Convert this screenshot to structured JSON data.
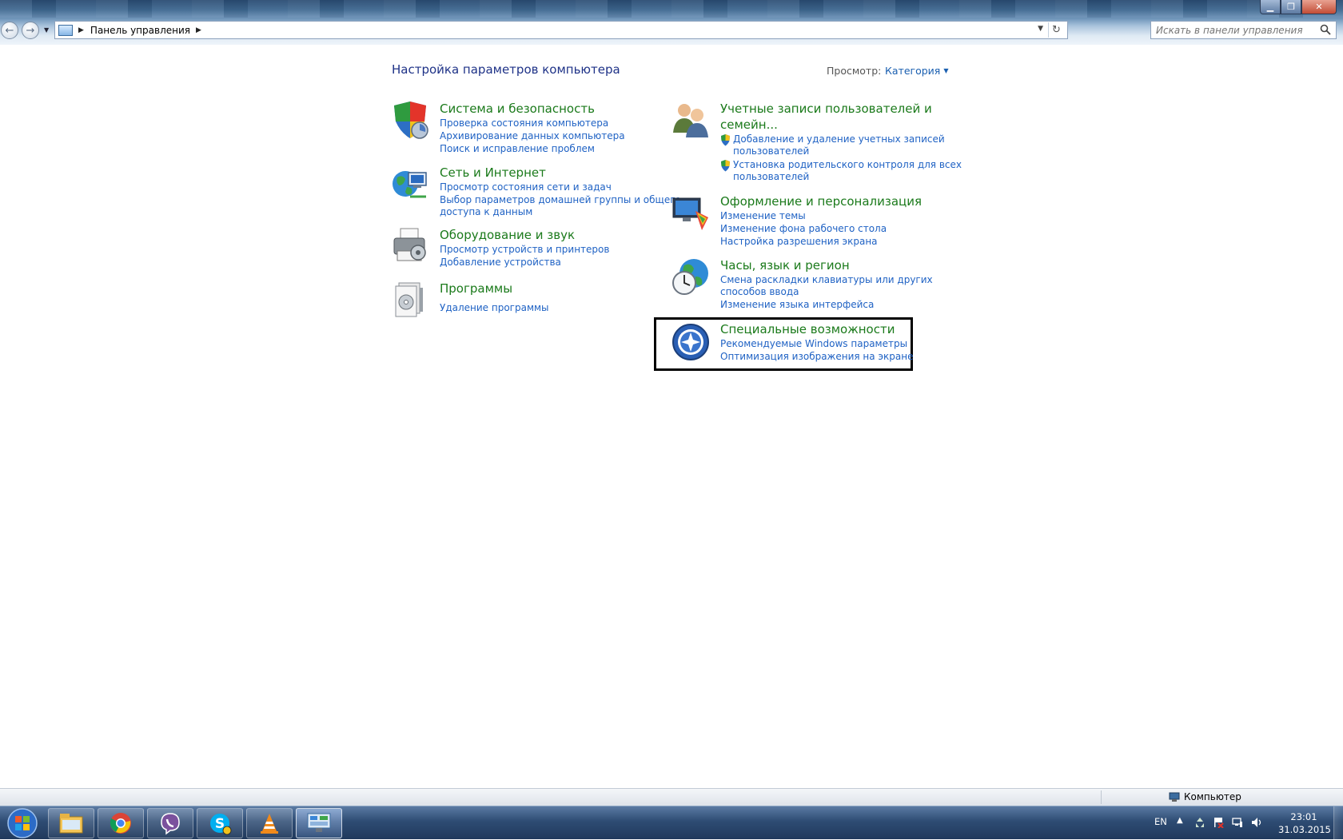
{
  "window": {
    "controls": {
      "minimize": "minimize-icon",
      "maximize": "restore-icon",
      "close": "close-icon"
    }
  },
  "nav": {
    "back_icon": "back-arrow-icon",
    "forward_icon": "forward-arrow-icon",
    "breadcrumb": [
      "Панель управления"
    ],
    "search_placeholder": "Искать в панели управления"
  },
  "content": {
    "title": "Настройка параметров компьютера",
    "view_label": "Просмотр:",
    "view_value": "Категория",
    "left_categories": [
      {
        "title": "Система и безопасность",
        "icon": "shield-icon",
        "links": [
          "Проверка состояния компьютера",
          "Архивирование данных компьютера",
          "Поиск и исправление проблем"
        ]
      },
      {
        "title": "Сеть и Интернет",
        "icon": "network-globe-icon",
        "links": [
          "Просмотр состояния сети и задач",
          "Выбор параметров домашней группы и общего",
          "доступа к данным"
        ]
      },
      {
        "title": "Оборудование и звук",
        "icon": "printer-icon",
        "links": [
          "Просмотр устройств и принтеров",
          "Добавление устройства"
        ]
      },
      {
        "title": "Программы",
        "icon": "programs-icon",
        "links": [
          "Удаление программы"
        ]
      }
    ],
    "right_categories": [
      {
        "title_lines": [
          "Учетные записи пользователей и",
          "семейн..."
        ],
        "icon": "users-icon",
        "links": [
          "Добавление и удаление учетных записей",
          "пользователей",
          "Установка родительского контроля для всех",
          "пользователей"
        ]
      },
      {
        "title": "Оформление и персонализация",
        "icon": "personalization-icon",
        "links": [
          "Изменение темы",
          "Изменение фона рабочего стола",
          "Настройка разрешения экрана"
        ]
      },
      {
        "title": "Часы, язык и регион",
        "icon": "clock-globe-icon",
        "links": [
          "Смена раскладки клавиатуры или других",
          "способов ввода",
          "Изменение языка интерфейса"
        ]
      },
      {
        "title": "Специальные возможности",
        "icon": "accessibility-icon",
        "links": [
          "Рекомендуемые Windows параметры",
          "Оптимизация изображения на экране"
        ]
      }
    ]
  },
  "statusbar": {
    "text": "Компьютер"
  },
  "taskbar": {
    "items": [
      "explorer-icon",
      "chrome-icon",
      "viber-icon",
      "skype-icon",
      "vlc-icon",
      "control-panel-icon"
    ],
    "tray": {
      "lang": "EN",
      "time": "23:01",
      "date": "31.03.2015"
    }
  }
}
